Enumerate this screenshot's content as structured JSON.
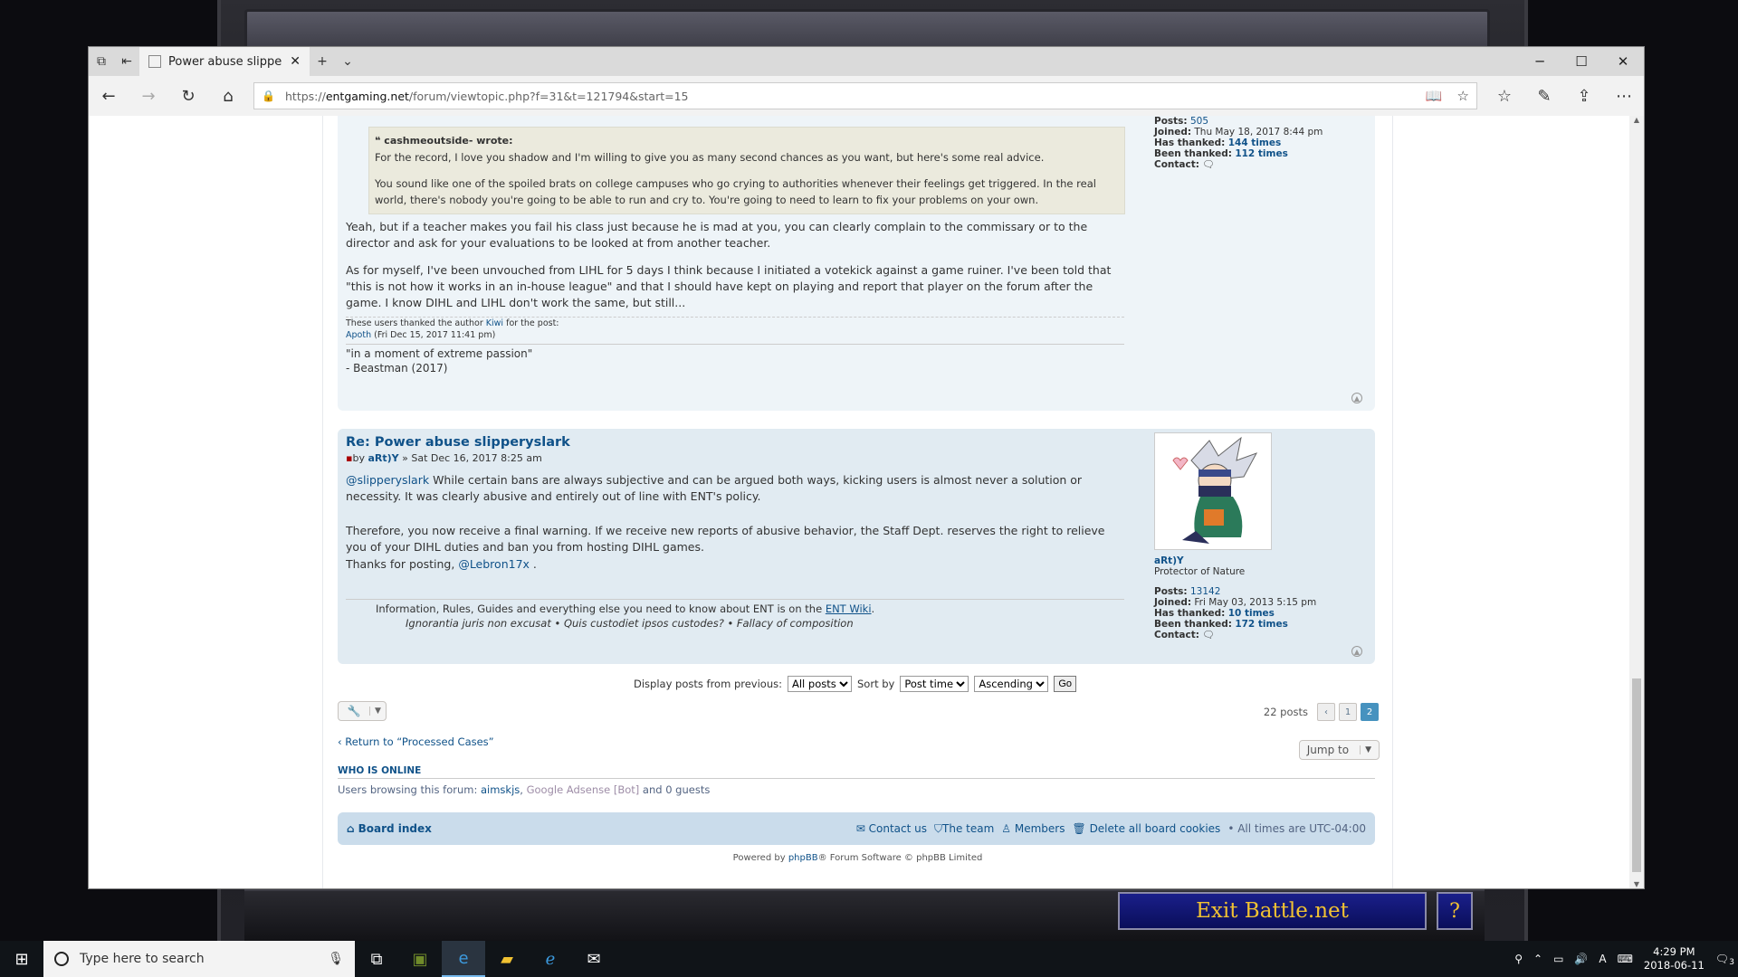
{
  "browser": {
    "tab_title": "Power abuse slipperysla",
    "url_prefix": "https://",
    "url_domain": "entgaming.net",
    "url_path": "/forum/viewtopic.php?f=31&t=121794&start=15"
  },
  "post1": {
    "quote_author": "cashmeoutside- wrote:",
    "quote_p1": "For the record, I love you shadow and I'm willing to give you as many second chances as you want, but here's some real advice.",
    "quote_p2": "You sound like one of the spoiled brats on college campuses who go crying to authorities whenever their feelings get triggered. In the real world, there's nobody you're going to be able to run and cry to. You're going to need to learn to fix your problems on your own.",
    "p1": "Yeah, but if a teacher makes you fail his class just because he is mad at you, you can clearly complain to the commissary or to the director and ask for your evaluations to be looked at from another teacher.",
    "p2": "As for myself, I've been unvouched from LIHL for 5 days I think because I initiated a votekick against a game ruiner. I've been told that \"this is not how it works in an in-house league\" and that I should have kept on playing and report that player on the forum after the game. I know DIHL and LIHL don't work the same, but still...",
    "thanks_prefix": "These users thanked the author",
    "thanks_author": "Kiwi",
    "thanks_suffix": "for the post:",
    "thanks_user": "Apoth",
    "thanks_date": "(Fri Dec 15, 2017 11:41 pm)",
    "sig1": "\"in a moment of extreme passion\"",
    "sig2": "- Beastman (2017)",
    "profile": {
      "posts_label": "Posts:",
      "posts": "505",
      "joined_label": "Joined:",
      "joined": "Thu May 18, 2017 8:44 pm",
      "thanked_label": "Has thanked:",
      "thanked": "144 times",
      "been_label": "Been thanked:",
      "been": "112 times",
      "contact_label": "Contact:"
    }
  },
  "post2": {
    "title": "Re: Power abuse slipperyslark",
    "by": "by",
    "author": "aRt)Y",
    "date": "» Sat Dec 16, 2017 8:25 am",
    "mention": "@slipperyslark",
    "p1": "While certain bans are always subjective and can be argued both ways, kicking users is almost never a solution or necessity. It was clearly abusive and entirely out of line with ENT's policy.",
    "p2": "Therefore, you now receive a final warning. If we receive new reports of abusive behavior, the Staff Dept. reserves the right to relieve you of your DIHL duties and ban you from hosting DIHL games.",
    "p3_prefix": "Thanks for posting,",
    "p3_mention": "@Lebron17x",
    "p3_suffix": ".",
    "sig_line1_prefix": "Information, Rules, Guides and everything else you need to know about ENT is on the",
    "sig_link": "ENT Wiki",
    "sig_line1_suffix": ".",
    "sig_line2": "Ignorantia juris non excusat • Quis custodiet ipsos custodes? • Fallacy of composition",
    "profile": {
      "name": "aRt)Y",
      "rank": "Protector of Nature",
      "posts_label": "Posts:",
      "posts": "13142",
      "joined_label": "Joined:",
      "joined": "Fri May 03, 2013 5:15 pm",
      "thanked_label": "Has thanked:",
      "thanked": "10 times",
      "been_label": "Been thanked:",
      "been": "172 times",
      "contact_label": "Contact:"
    }
  },
  "controls": {
    "display_label": "Display posts from previous:",
    "display_value": "All posts",
    "sort_label": "Sort by",
    "sort_value": "Post time",
    "order_value": "Ascending",
    "go": "Go",
    "posts_count": "22 posts",
    "page_prev": "‹",
    "page1": "1",
    "page2": "2",
    "return": "Return to “Processed Cases”",
    "jump_to": "Jump to"
  },
  "online": {
    "heading": "WHO IS ONLINE",
    "prefix": "Users browsing this forum:",
    "user1": "aimskjs",
    "sep": ",",
    "user2": "Google Adsense [Bot]",
    "suffix": "and 0 guests"
  },
  "footer": {
    "board_index": "Board index",
    "contact": "Contact us",
    "team": "The team",
    "members": "Members",
    "delete_cookies": "Delete all board cookies",
    "times": "• All times are UTC-04:00",
    "powered_prefix": "Powered by",
    "powered_link": "phpBB",
    "powered_suffix": "® Forum Software © phpBB Limited"
  },
  "game": {
    "exit": "Exit Battle.net",
    "help": "?"
  },
  "taskbar": {
    "search_placeholder": "Type here to search",
    "time": "4:29 PM",
    "date": "2018-06-11",
    "notifications": "3"
  }
}
